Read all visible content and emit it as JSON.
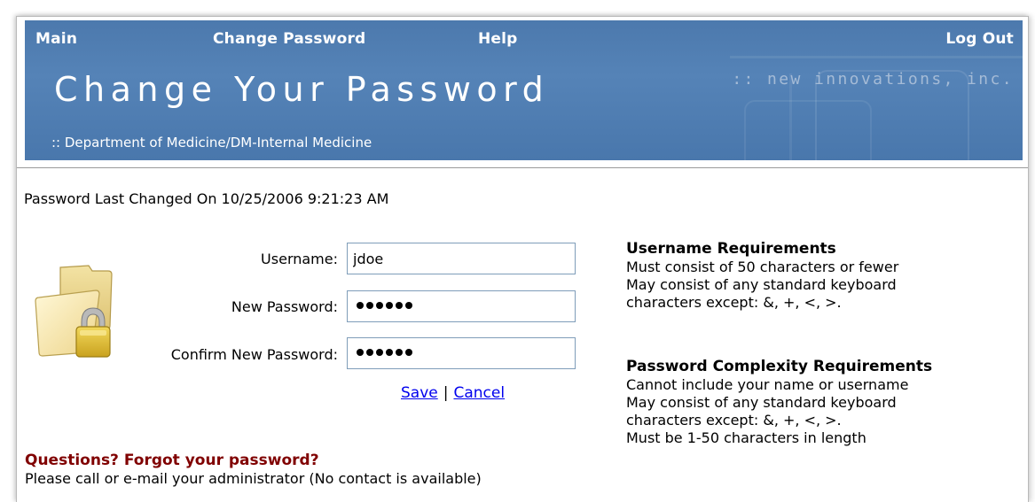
{
  "nav": {
    "main": "Main",
    "change_password": "Change Password",
    "help": "Help",
    "logout": "Log Out"
  },
  "header": {
    "title": "Change Your Password",
    "brand": ":: new innovations, inc.",
    "department": ":: Department of Medicine/DM-Internal Medicine"
  },
  "last_changed": "Password Last Changed On 10/25/2006 9:21:23 AM",
  "form": {
    "username_label": "Username:",
    "username_value": "jdoe",
    "new_password_label": "New Password:",
    "confirm_password_label": "Confirm New Password:",
    "save_label": "Save",
    "separator": "|",
    "cancel_label": "Cancel"
  },
  "username_requirements": {
    "title": "Username Requirements",
    "lines": [
      "Must consist of 50 characters or fewer",
      "May consist of any standard keyboard",
      "characters except: &, +, <, >."
    ]
  },
  "password_requirements": {
    "title": "Password Complexity Requirements",
    "lines": [
      "Cannot include your name or username",
      "May consist of any standard keyboard",
      "characters except: &, +, <, >.",
      "Must be 1-50 characters in length"
    ]
  },
  "help": {
    "question": "Questions? Forgot your password?",
    "contact": "Please call or e-mail your administrator (No contact is available)"
  },
  "colors": {
    "header_blue": "#5583b7",
    "question_red": "#800000",
    "link_blue": "#0000ee"
  }
}
